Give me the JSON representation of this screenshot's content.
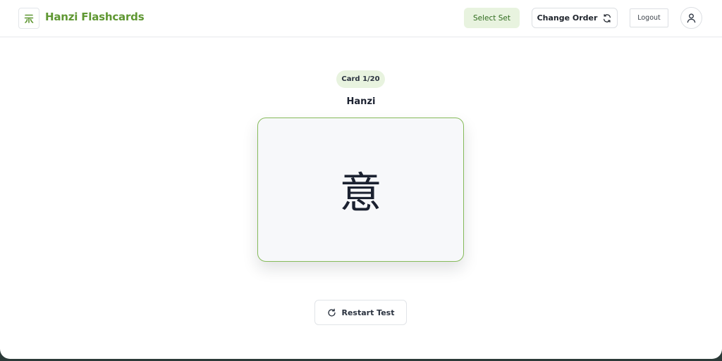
{
  "app": {
    "brand_name": "Hanzi Flashcards",
    "logo_icon": "hanzi-logo-icon",
    "accent_color": "#5f9732"
  },
  "header": {
    "select_set_label": "Select Set",
    "change_order_label": "Change Order",
    "change_order_icon": "shuffle-refresh-icon",
    "logout_label": "Logout",
    "user_icon": "user-icon"
  },
  "main": {
    "card_counter": "Card 1/20",
    "side_label": "Hanzi",
    "card_character": "意",
    "restart_label": "Restart Test",
    "restart_icon": "restart-icon"
  }
}
